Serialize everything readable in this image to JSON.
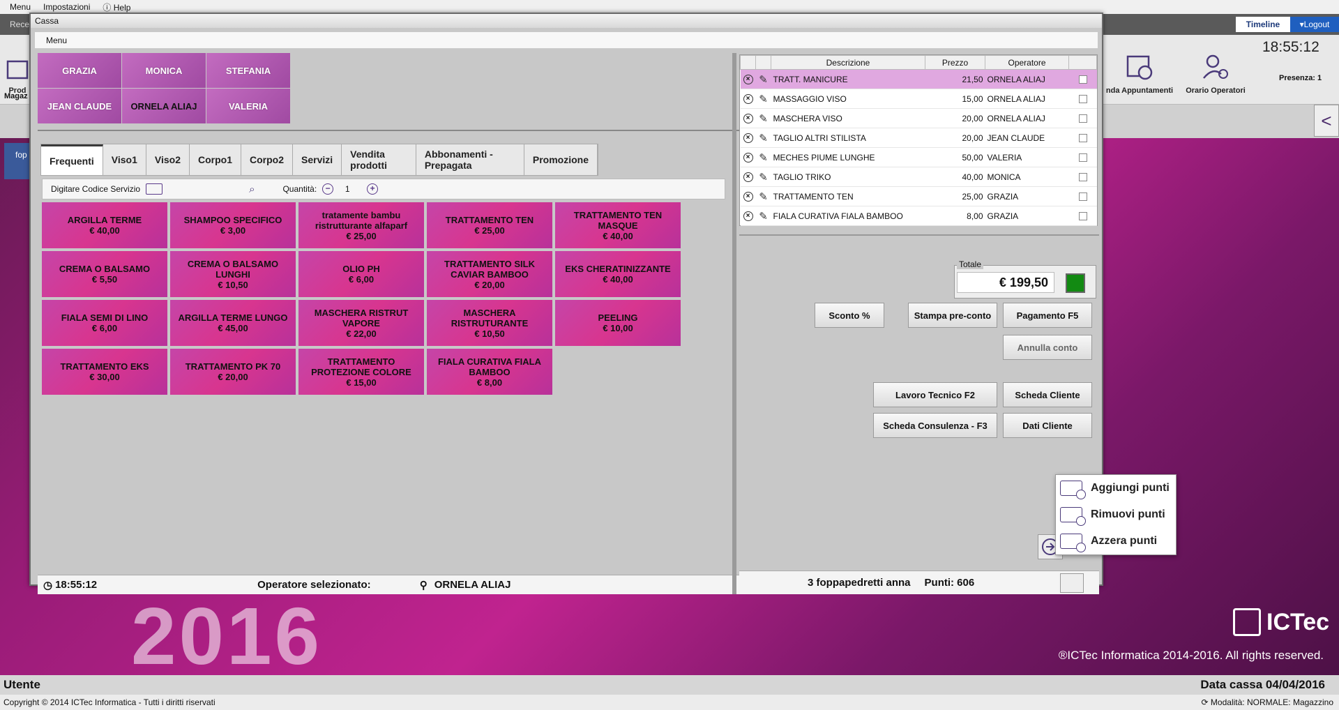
{
  "topmenu": {
    "menu": "Menu",
    "settings": "Impostazioni",
    "help": "Help"
  },
  "bg": {
    "tab_first": "Rece",
    "timeline": "Timeline",
    "logout": "Logout",
    "tool_prod": "Prod",
    "tool_agenda": "nda Appuntamenti",
    "tool_orario": "Orario Operatori",
    "clock": "18:55:12",
    "presenza": "Presenza: 1",
    "magaz": "Magaz",
    "side_item": "fop",
    "collapse": "<",
    "year": "2016",
    "logo": "ICTec",
    "rights": "®ICTec Informatica 2014-2016. All rights reserved.",
    "status_left": "Utente",
    "status_right": "Data cassa 04/04/2016",
    "copyright": "Copyright © 2014 ICTec Informatica - Tutti i diritti riservati",
    "mode": "Modalità: NORMALE: Magazzino"
  },
  "cassa": {
    "title": "Cassa",
    "menu": "Menu",
    "operators": [
      "GRAZIA",
      "MONICA",
      "STEFANIA",
      "JEAN CLAUDE",
      "ORNELA ALIAJ",
      "VALERIA"
    ],
    "tabs": [
      "Frequenti",
      "Viso1",
      "Viso2",
      "Corpo1",
      "Corpo2",
      "Servizi",
      "Vendita prodotti",
      "Abbonamenti - Prepagata",
      "Promozione"
    ],
    "code_label": "Digitare Codice Servizio",
    "qty_label": "Quantità:",
    "qty_value": "1",
    "products": [
      {
        "name": "ARGILLA TERME",
        "price": "€ 40,00"
      },
      {
        "name": "SHAMPOO SPECIFICO",
        "price": "€ 3,00"
      },
      {
        "name": "tratamente bambu ristrutturante alfaparf",
        "price": "€ 25,00"
      },
      {
        "name": "TRATTAMENTO  TEN",
        "price": "€ 25,00"
      },
      {
        "name": "TRATTAMENTO TEN MASQUE",
        "price": "€ 40,00"
      },
      {
        "name": "CREMA O BALSAMO",
        "price": "€ 5,50"
      },
      {
        "name": "CREMA O BALSAMO LUNGHI",
        "price": "€ 10,50"
      },
      {
        "name": "OLIO PH",
        "price": "€ 6,00"
      },
      {
        "name": "TRATTAMENTO SILK CAVIAR  BAMBOO",
        "price": "€ 20,00"
      },
      {
        "name": "EKS CHERATINIZZANTE",
        "price": "€ 40,00"
      },
      {
        "name": "FIALA  SEMI DI LINO",
        "price": "€ 6,00"
      },
      {
        "name": "ARGILLA TERME LUNGO",
        "price": "€ 45,00"
      },
      {
        "name": "MASCHERA RISTRUT VAPORE",
        "price": "€ 22,00"
      },
      {
        "name": "MASCHERA RISTRUTURANTE",
        "price": "€ 10,50"
      },
      {
        "name": "PEELING",
        "price": "€ 10,00"
      },
      {
        "name": "TRATTAMENTO EKS",
        "price": "€ 30,00"
      },
      {
        "name": "TRATTAMENTO PK 70",
        "price": "€ 20,00"
      },
      {
        "name": "TRATTAMENTO PROTEZIONE COLORE",
        "price": "€ 15,00"
      },
      {
        "name": "FIALA CURATIVA FIALA BAMBOO",
        "price": "€ 8,00"
      }
    ],
    "footer_time": "18:55:12",
    "footer_op_label": "Operatore selezionato:",
    "footer_op_name": "ORNELA ALIAJ",
    "orders_headers": [
      "Descrizione",
      "Prezzo",
      "Operatore"
    ],
    "orders": [
      {
        "desc": "TRATT. MANICURE",
        "price": "21,50",
        "op": "ORNELA ALIAJ"
      },
      {
        "desc": "MASSAGGIO VISO",
        "price": "15,00",
        "op": "ORNELA ALIAJ"
      },
      {
        "desc": "MASCHERA VISO",
        "price": "20,00",
        "op": "ORNELA ALIAJ"
      },
      {
        "desc": "TAGLIO ALTRI STILISTA",
        "price": "20,00",
        "op": "JEAN CLAUDE"
      },
      {
        "desc": "MECHES PIUME  LUNGHE",
        "price": "50,00",
        "op": "VALERIA"
      },
      {
        "desc": "TAGLIO TRIKO",
        "price": "40,00",
        "op": "MONICA"
      },
      {
        "desc": "TRATTAMENTO  TEN",
        "price": "25,00",
        "op": "GRAZIA"
      },
      {
        "desc": "FIALA CURATIVA FIALA BAMBOO",
        "price": "8,00",
        "op": "GRAZIA"
      }
    ],
    "totale_label": "Totale",
    "totale_value": "€ 199,50",
    "btn_sconto": "Sconto %",
    "btn_preconto": "Stampa pre-conto",
    "btn_pagamento": "Pagamento F5",
    "btn_annulla": "Annulla conto",
    "btn_lavoro": "Lavoro Tecnico F2",
    "btn_scheda_cliente": "Scheda Cliente",
    "btn_consulenza": "Scheda Consulenza - F3",
    "btn_dati": "Dati Cliente",
    "customer": "3 foppapedretti  anna",
    "points": "Punti: 606",
    "popup": [
      "Aggiungi punti",
      "Rimuovi punti",
      "Azzera punti"
    ]
  }
}
